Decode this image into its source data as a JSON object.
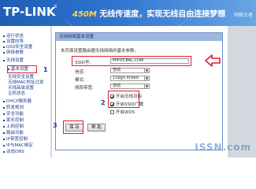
{
  "header": {
    "logo": "TP-LINK",
    "logo_reg": "®",
    "slogan_accent": "450M",
    "slogan": "无线传速度，实现无线自由连接梦想",
    "watermark_site": "网络王者"
  },
  "sidebar": {
    "items": [
      {
        "label": "运行状态"
      },
      {
        "label": "设置向导"
      },
      {
        "label": "QSS安全设置"
      },
      {
        "label": "网络参数"
      },
      {
        "label": "无线设置"
      },
      {
        "label": "基本设置"
      },
      {
        "label": "无线安全设置"
      },
      {
        "label": "无线MAC地址过滤"
      },
      {
        "label": "无线高级设置"
      },
      {
        "label": "主机状态"
      },
      {
        "label": "DHCP服务器"
      },
      {
        "label": "转发规则"
      },
      {
        "label": "安全功能"
      },
      {
        "label": "家长控制"
      },
      {
        "label": "上网控制"
      },
      {
        "label": "路由功能"
      },
      {
        "label": "IP带宽控制"
      },
      {
        "label": "IP与MAC绑定"
      },
      {
        "label": "动态DNS"
      }
    ]
  },
  "panel": {
    "title": "无线网络基本设置",
    "description": "本页面设置路由器无线网络的基本参数。",
    "fields": {
      "ssid_label": "SSID号:",
      "ssid_value": "PPP.PCB4L.COM",
      "channel_label": "信道:",
      "channel_value": "自动",
      "mode_label": "模式:",
      "mode_value": "11bgn mixed",
      "bandwidth_label": "频段带宽:",
      "bandwidth_value": "自动"
    },
    "checks": {
      "enable_wireless": "开启无线功能",
      "enable_ssid_broadcast": "开启SSID广播",
      "enable_wds": "开启WDS"
    },
    "buttons": {
      "save": "保 存",
      "help": "帮 助"
    }
  },
  "markers": {
    "step1": "1",
    "step2": "2",
    "step3": "3"
  },
  "watermark": "ISSN.com",
  "colors": {
    "header_blue": "#2f74cf",
    "panel_border": "#6c8fc6",
    "annotation_red": "#e0202a",
    "nav_text": "#1a3d8f"
  }
}
